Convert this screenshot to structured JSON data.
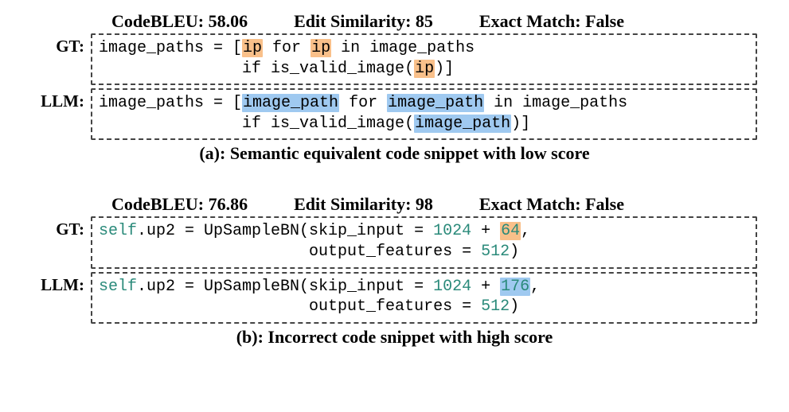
{
  "example_a": {
    "metrics": {
      "codebleu_label": "CodeBLEU: 58.06",
      "editsim_label": "Edit Similarity: 85",
      "exact_label": "Exact Match: False"
    },
    "gt_label": "GT:",
    "llm_label": "LLM:",
    "gt_code": {
      "prefix1": "image_paths = [",
      "hl1": "ip",
      "mid1": " for ",
      "hl2": "ip",
      "after1": " in image_paths",
      "indent2": "               if is_valid_image(",
      "hl3": "ip",
      "tail2": ")]"
    },
    "llm_code": {
      "prefix1": "image_paths = [",
      "hl1": "image_path",
      "mid1": " for ",
      "hl2": "image_path",
      "after1": " in image_paths",
      "indent2": "               if is_valid_image(",
      "hl3": "image_path",
      "tail2": ")]"
    },
    "caption": "(a): Semantic equivalent code snippet with low score"
  },
  "example_b": {
    "metrics": {
      "codebleu_label": "CodeBLEU: 76.86",
      "editsim_label": "Edit Similarity: 98",
      "exact_label": "Exact Match: False"
    },
    "gt_label": "GT:",
    "llm_label": "LLM:",
    "gt_code": {
      "self1": "self",
      "dot_attr": ".up2 = UpSampleBN(skip_input = ",
      "num1": "1024",
      "plus": " + ",
      "hlnum": "64",
      "comma": ",",
      "indent2": "                      output_features = ",
      "num2": "512",
      "tail": ")"
    },
    "llm_code": {
      "self1": "self",
      "dot_attr": ".up2 = UpSampleBN(skip_input = ",
      "num1": "1024",
      "plus": " + ",
      "hlnum": "176",
      "comma": ",",
      "indent2": "                      output_features = ",
      "num2": "512",
      "tail": ")"
    },
    "caption": "(b): Incorrect code snippet with high score"
  }
}
